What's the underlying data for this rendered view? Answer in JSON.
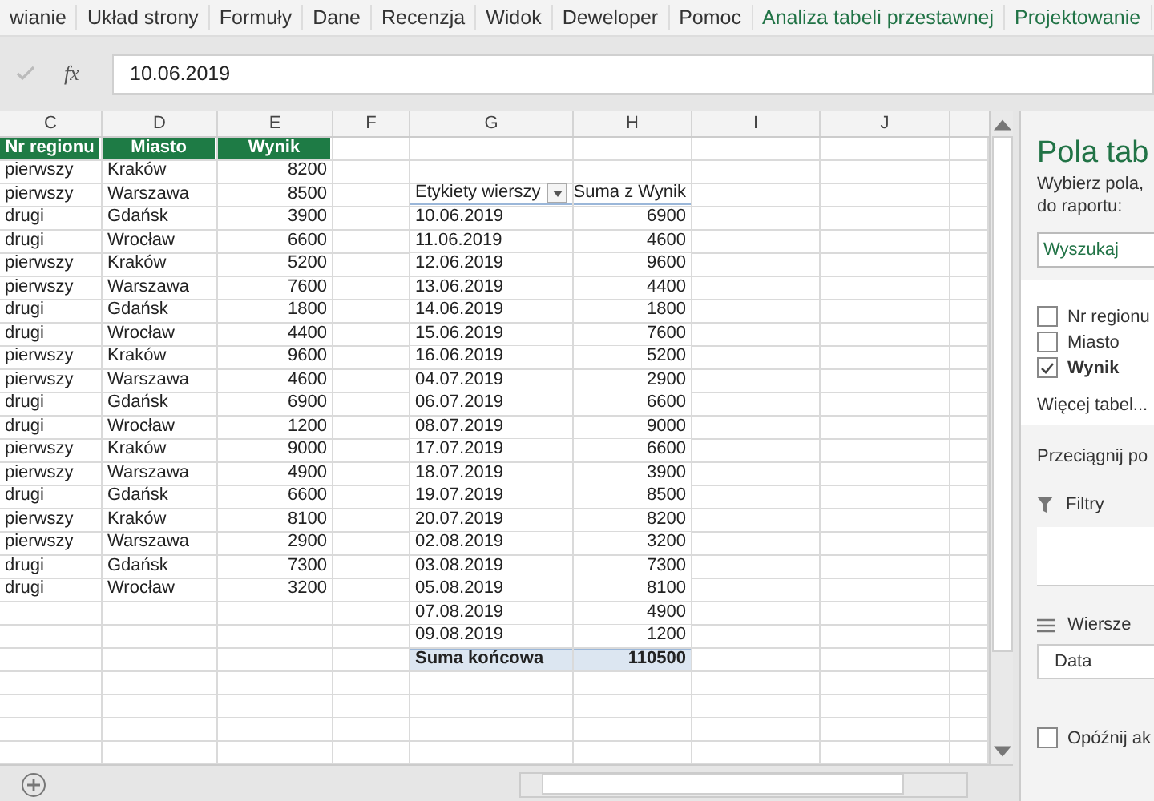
{
  "ribbon_tabs": [
    {
      "label": "wianie",
      "green": false
    },
    {
      "label": "Układ strony",
      "green": false
    },
    {
      "label": "Formuły",
      "green": false
    },
    {
      "label": "Dane",
      "green": false
    },
    {
      "label": "Recenzja",
      "green": false
    },
    {
      "label": "Widok",
      "green": false
    },
    {
      "label": "Deweloper",
      "green": false
    },
    {
      "label": "Pomoc",
      "green": false
    },
    {
      "label": "Analiza tabeli przestawnej",
      "green": true
    },
    {
      "label": "Projektowanie",
      "green": true
    }
  ],
  "formula_bar": {
    "fx": "fx",
    "value": "10.06.2019"
  },
  "columns": [
    "C",
    "D",
    "E",
    "F",
    "G",
    "H",
    "I",
    "J"
  ],
  "table": {
    "headers": [
      "Nr regionu",
      "Miasto",
      "Wynik"
    ],
    "rows": [
      [
        "pierwszy",
        "Kraków",
        "8200"
      ],
      [
        "pierwszy",
        "Warszawa",
        "8500"
      ],
      [
        "drugi",
        "Gdańsk",
        "3900"
      ],
      [
        "drugi",
        "Wrocław",
        "6600"
      ],
      [
        "pierwszy",
        "Kraków",
        "5200"
      ],
      [
        "pierwszy",
        "Warszawa",
        "7600"
      ],
      [
        "drugi",
        "Gdańsk",
        "1800"
      ],
      [
        "drugi",
        "Wrocław",
        "4400"
      ],
      [
        "pierwszy",
        "Kraków",
        "9600"
      ],
      [
        "pierwszy",
        "Warszawa",
        "4600"
      ],
      [
        "drugi",
        "Gdańsk",
        "6900"
      ],
      [
        "drugi",
        "Wrocław",
        "1200"
      ],
      [
        "pierwszy",
        "Kraków",
        "9000"
      ],
      [
        "pierwszy",
        "Warszawa",
        "4900"
      ],
      [
        "drugi",
        "Gdańsk",
        "6600"
      ],
      [
        "pierwszy",
        "Kraków",
        "8100"
      ],
      [
        "pierwszy",
        "Warszawa",
        "2900"
      ],
      [
        "drugi",
        "Gdańsk",
        "7300"
      ],
      [
        "drugi",
        "Wrocław",
        "3200"
      ]
    ]
  },
  "pivot": {
    "headers": [
      "Etykiety wierszy",
      "Suma z Wynik"
    ],
    "rows": [
      [
        "10.06.2019",
        "6900"
      ],
      [
        "11.06.2019",
        "4600"
      ],
      [
        "12.06.2019",
        "9600"
      ],
      [
        "13.06.2019",
        "4400"
      ],
      [
        "14.06.2019",
        "1800"
      ],
      [
        "15.06.2019",
        "7600"
      ],
      [
        "16.06.2019",
        "5200"
      ],
      [
        "04.07.2019",
        "2900"
      ],
      [
        "06.07.2019",
        "6600"
      ],
      [
        "08.07.2019",
        "9000"
      ],
      [
        "17.07.2019",
        "6600"
      ],
      [
        "18.07.2019",
        "3900"
      ],
      [
        "19.07.2019",
        "8500"
      ],
      [
        "20.07.2019",
        "8200"
      ],
      [
        "02.08.2019",
        "3200"
      ],
      [
        "03.08.2019",
        "7300"
      ],
      [
        "05.08.2019",
        "8100"
      ],
      [
        "07.08.2019",
        "4900"
      ],
      [
        "09.08.2019",
        "1200"
      ]
    ],
    "total": [
      "Suma końcowa",
      "110500"
    ]
  },
  "panel": {
    "title": "Pola tab",
    "intro": [
      "Wybierz pola,",
      "do raportu:"
    ],
    "search": {
      "placeholder": "Wyszukaj"
    },
    "fields": [
      {
        "label": "Nr regionu",
        "checked": false
      },
      {
        "label": "Miasto",
        "checked": false
      },
      {
        "label": "Wynik",
        "checked": true
      }
    ],
    "more_tables": "Więcej tabel...",
    "drag_hint": "Przeciągnij po",
    "filters": {
      "label": "Filtry"
    },
    "rows_area": {
      "label": "Wiersze",
      "items": [
        "Data"
      ]
    },
    "defer": {
      "label": "Opóźnij ak",
      "checked": false
    }
  }
}
